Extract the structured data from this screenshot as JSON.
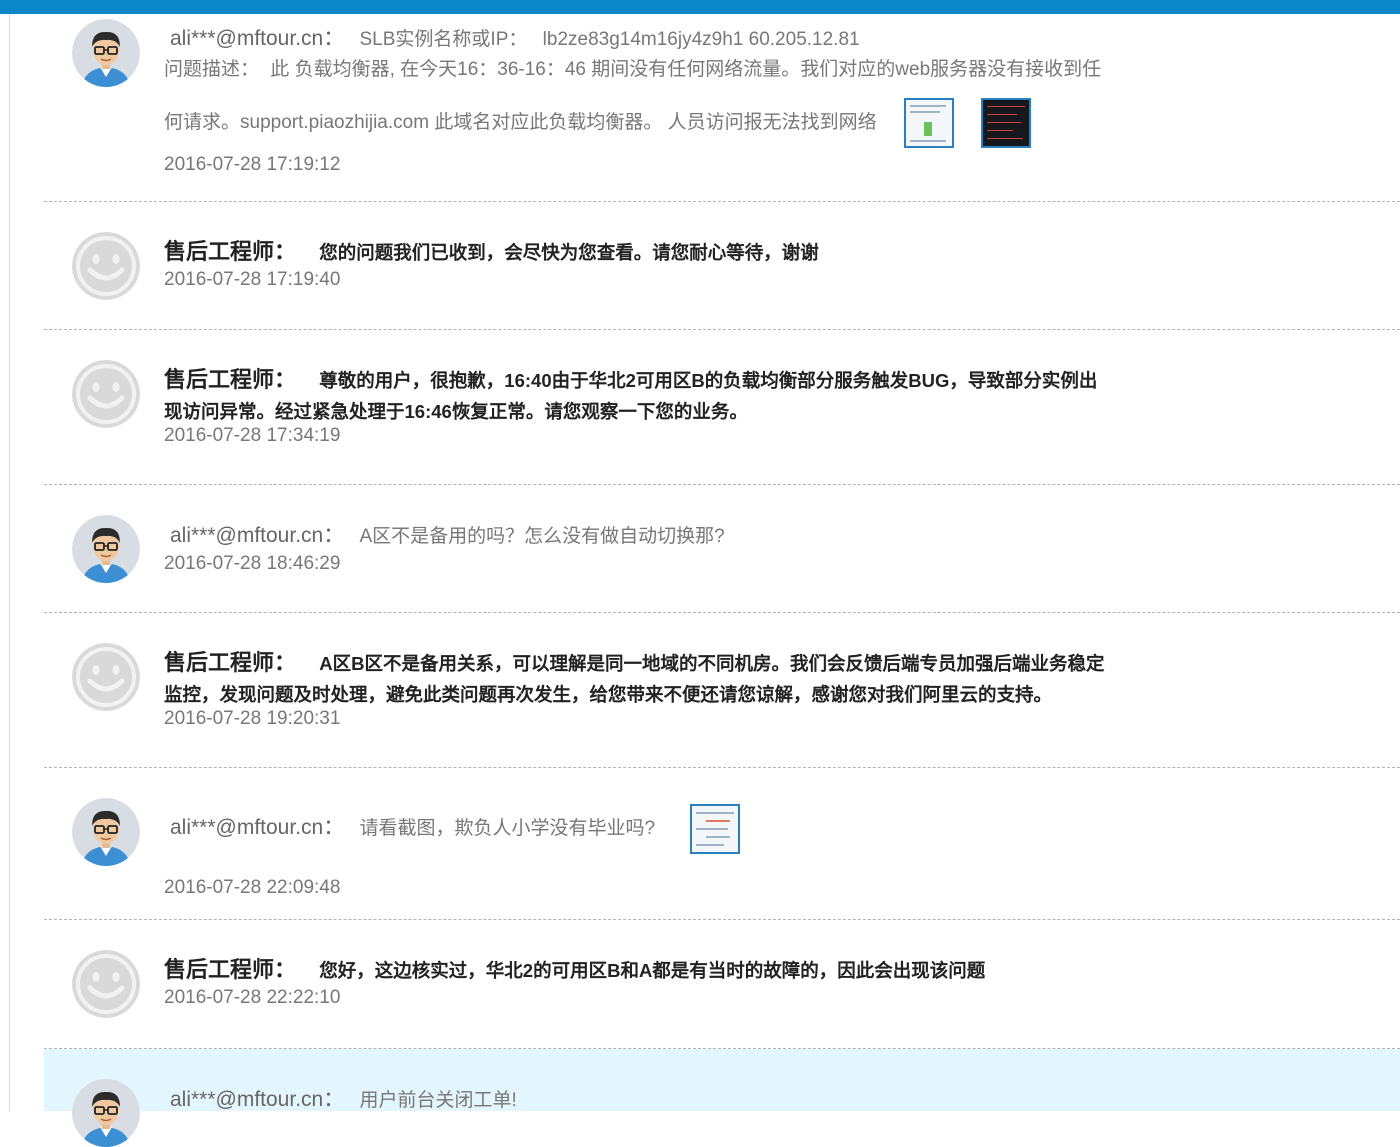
{
  "colors": {
    "topbar": "#0b87c9",
    "closed_bg": "#e4f6fd",
    "thumb_border": "#2a7fc0"
  },
  "messages": [
    {
      "role": "user",
      "name": "ali***@mftour.cn：",
      "slb_label": "SLB实例名称或IP：",
      "slb_value": "lb2ze83g14m16jy4z9h1 60.205.12.81",
      "desc_label": "问题描述：",
      "desc_line1": "此 负载均衡器, 在今天16：36-16：46 期间没有任何网络流量。我们对应的web服务器没有接收到任",
      "desc_line2": "何请求。support.piaozhijia.com  此域名对应此负载均衡器。 人员访问报无法找到网络",
      "time": "2016-07-28 17:19:12"
    },
    {
      "role": "engineer",
      "name": "售后工程师：",
      "content": "您的问题我们已收到，会尽快为您查看。请您耐心等待，谢谢",
      "time": "2016-07-28 17:19:40"
    },
    {
      "role": "engineer",
      "name": "售后工程师：",
      "content": "尊敬的用户，很抱歉，16:40由于华北2可用区B的负载均衡部分服务触发BUG，导致部分实例出",
      "content_line2": "现访问异常。经过紧急处理于16:46恢复正常。请您观察一下您的业务。",
      "time": "2016-07-28 17:34:19"
    },
    {
      "role": "user",
      "name": "ali***@mftour.cn：",
      "content": "A区不是备用的吗？怎么没有做自动切换那?",
      "time": "2016-07-28 18:46:29"
    },
    {
      "role": "engineer",
      "name": "售后工程师：",
      "content": "A区B区不是备用关系，可以理解是同一地域的不同机房。我们会反馈后端专员加强后端业务稳定",
      "content_line2": "监控，发现问题及时处理，避免此类问题再次发生，给您带来不便还请您谅解，感谢您对我们阿里云的支持。",
      "time": "2016-07-28 19:20:31"
    },
    {
      "role": "user",
      "name": "ali***@mftour.cn：",
      "content": "请看截图，欺负人小学没有毕业吗?",
      "time": "2016-07-28 22:09:48"
    },
    {
      "role": "engineer",
      "name": "售后工程师：",
      "content": "您好，这边核实过，华北2的可用区B和A都是有当时的故障的，因此会出现该问题",
      "time": "2016-07-28 22:22:10"
    },
    {
      "role": "user",
      "name": "ali***@mftour.cn：",
      "content": "用户前台关闭工单!"
    }
  ]
}
